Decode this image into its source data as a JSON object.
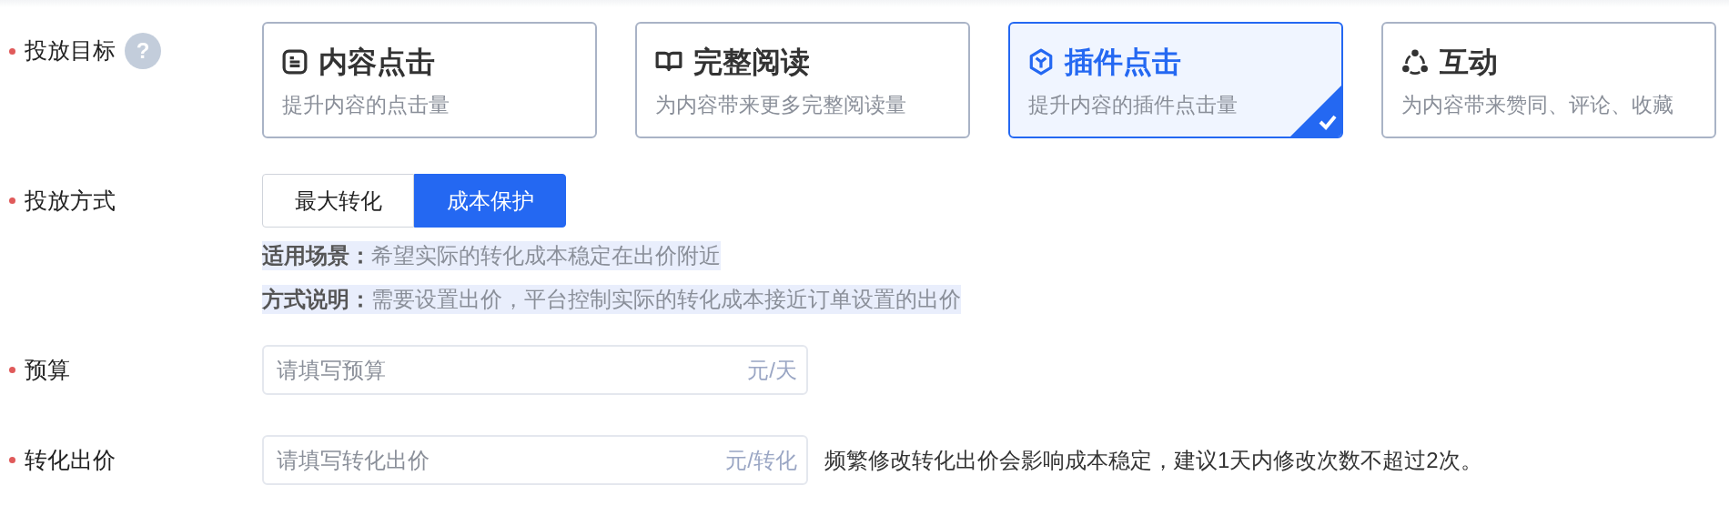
{
  "fields": [
    {
      "kind": "cards",
      "label": "投放目标",
      "required": true,
      "help": "?",
      "options": [
        {
          "title": "内容点击",
          "subtitle": "提升内容的点击量",
          "selected": false
        },
        {
          "title": "完整阅读",
          "subtitle": "为内容带来更多完整阅读量",
          "selected": false
        },
        {
          "title": "插件点击",
          "subtitle": "提升内容的插件点击量",
          "selected": true
        },
        {
          "title": "互动",
          "subtitle": "为内容带来赞同、评论、收藏",
          "selected": false
        }
      ]
    },
    {
      "kind": "segmented",
      "label": "投放方式",
      "required": true,
      "options": [
        {
          "label": "最大转化",
          "selected": false
        },
        {
          "label": "成本保护",
          "selected": true
        }
      ],
      "notes": [
        {
          "term": "适用场景：",
          "text": "希望实际的转化成本稳定在出价附近"
        },
        {
          "term": "方式说明：",
          "text": "需要设置出价，平台控制实际的转化成本接近订单设置的出价"
        }
      ]
    },
    {
      "kind": "input",
      "label": "预算",
      "required": true,
      "placeholder": "请填写预算",
      "suffix": "元/天"
    },
    {
      "kind": "input",
      "label": "转化出价",
      "required": true,
      "placeholder": "请填写转化出价",
      "suffix": "元/转化",
      "hint": "频繁修改转化出价会影响成本稳定，建议1天内修改次数不超过2次。"
    }
  ]
}
